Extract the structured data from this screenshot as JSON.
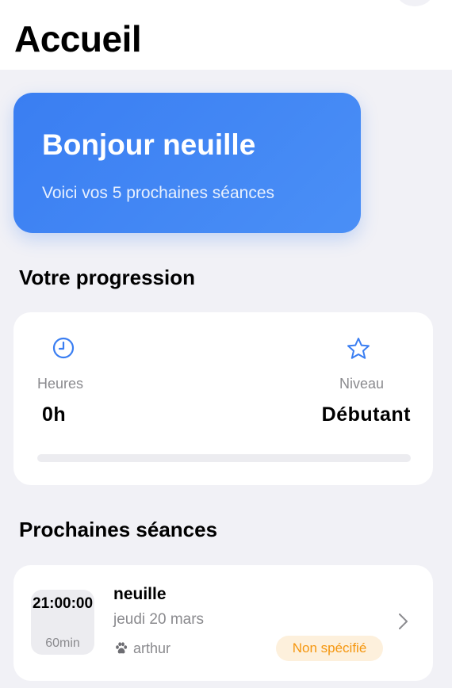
{
  "header": {
    "title": "Accueil"
  },
  "welcome": {
    "title": "Bonjour neuille",
    "subtitle": "Voici vos 5 prochaines séances"
  },
  "progress": {
    "section_title": "Votre progression",
    "hours_icon": "clock-icon",
    "hours_label": "Heures",
    "hours_value": "0h",
    "level_icon": "star-icon",
    "level_label": "Niveau",
    "level_value": "Débutant",
    "progress_fraction": 0
  },
  "sessions": {
    "section_title": "Prochaines séances",
    "items": [
      {
        "time": "21:00:00",
        "duration": "60min",
        "name": "neuille",
        "date": "jeudi 20 mars",
        "trainer_icon": "paw-icon",
        "trainer": "arthur",
        "status": "Non spécifié"
      }
    ]
  },
  "colors": {
    "accent": "#3a7ef2",
    "background": "#f1f1f6",
    "muted_text": "#8a8a8e",
    "badge_bg": "#fdf0dc",
    "badge_text": "#f5960e"
  }
}
